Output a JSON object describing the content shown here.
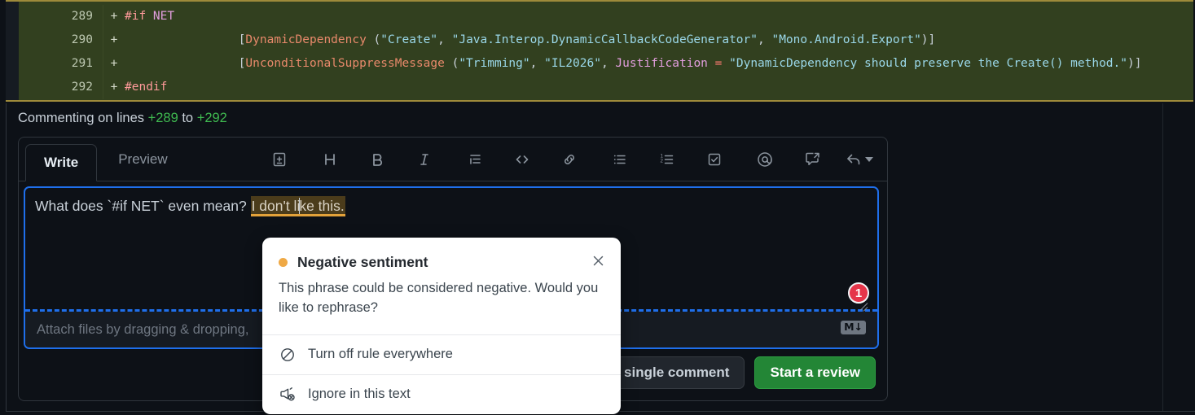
{
  "diff": {
    "rows": [
      {
        "line": "289",
        "marker": "+",
        "indent": "",
        "segments": [
          {
            "t": "#if ",
            "c": "k-pre"
          },
          {
            "t": "NET",
            "c": "k-sym"
          }
        ]
      },
      {
        "line": "290",
        "marker": "+",
        "indent": "                ",
        "segments": [
          {
            "t": "[",
            "c": "k-punct"
          },
          {
            "t": "DynamicDependency",
            "c": "k-attr"
          },
          {
            "t": " (",
            "c": "k-punct"
          },
          {
            "t": "\"Create\"",
            "c": "k-str"
          },
          {
            "t": ", ",
            "c": "k-punct"
          },
          {
            "t": "\"Java.Interop.DynamicCallbackCodeGenerator\"",
            "c": "k-str"
          },
          {
            "t": ", ",
            "c": "k-punct"
          },
          {
            "t": "\"Mono.Android.Export\"",
            "c": "k-str"
          },
          {
            "t": ")]",
            "c": "k-punct"
          }
        ]
      },
      {
        "line": "291",
        "marker": "+",
        "indent": "                ",
        "segments": [
          {
            "t": "[",
            "c": "k-punct"
          },
          {
            "t": "UnconditionalSuppressMessage",
            "c": "k-attr"
          },
          {
            "t": " (",
            "c": "k-punct"
          },
          {
            "t": "\"Trimming\"",
            "c": "k-str"
          },
          {
            "t": ", ",
            "c": "k-punct"
          },
          {
            "t": "\"IL2026\"",
            "c": "k-str"
          },
          {
            "t": ", ",
            "c": "k-punct"
          },
          {
            "t": "Justification",
            "c": "k-sym"
          },
          {
            "t": " ",
            "c": "k-punct"
          },
          {
            "t": "=",
            "c": "k-op"
          },
          {
            "t": " ",
            "c": "k-punct"
          },
          {
            "t": "\"DynamicDependency should preserve the Create() method.\"",
            "c": "k-str"
          },
          {
            "t": ")]",
            "c": "k-punct"
          }
        ]
      },
      {
        "line": "292",
        "marker": "+",
        "indent": "",
        "segments": [
          {
            "t": "#endif",
            "c": "k-pre"
          }
        ]
      }
    ]
  },
  "commenting": {
    "prefix": "Commenting on lines ",
    "from": "+289",
    "middle": " to ",
    "to": "+292"
  },
  "tabs": {
    "write": "Write",
    "preview": "Preview"
  },
  "toolbar": {
    "items": [
      {
        "name": "add-suggestion-icon",
        "title": "Add a suggestion"
      },
      {
        "name": "heading-icon",
        "title": "Heading"
      },
      {
        "name": "bold-icon",
        "title": "Bold"
      },
      {
        "name": "italic-icon",
        "title": "Italic"
      },
      {
        "name": "quote-icon",
        "title": "Quote"
      },
      {
        "name": "code-icon",
        "title": "Code"
      },
      {
        "name": "link-icon",
        "title": "Link"
      },
      {
        "name": "unordered-list-icon",
        "title": "Unordered list"
      },
      {
        "name": "ordered-list-icon",
        "title": "Ordered list"
      },
      {
        "name": "task-list-icon",
        "title": "Task list"
      },
      {
        "name": "mention-icon",
        "title": "Mention"
      },
      {
        "name": "saved-reply-icon",
        "title": "Saved replies"
      },
      {
        "name": "reply-icon",
        "title": "Reference"
      }
    ]
  },
  "editor": {
    "text_before": "What does `#if NET` even mean? ",
    "highlighted": "I don't like this.",
    "attach_hint": "Attach files by dragging & dropping,",
    "markdown_badge": "M↓",
    "error_count": "1"
  },
  "actions": {
    "add_single_comment": "Add single comment",
    "start_review": "Start a review"
  },
  "popup": {
    "title": "Negative sentiment",
    "dot_color": "#efa945",
    "body": "This phrase could be considered negative. Would you like to rephrase?",
    "items": [
      {
        "label": "Turn off rule everywhere",
        "icon": "block-icon"
      },
      {
        "label": "Ignore in this text",
        "icon": "megaphone-off-icon"
      }
    ]
  }
}
